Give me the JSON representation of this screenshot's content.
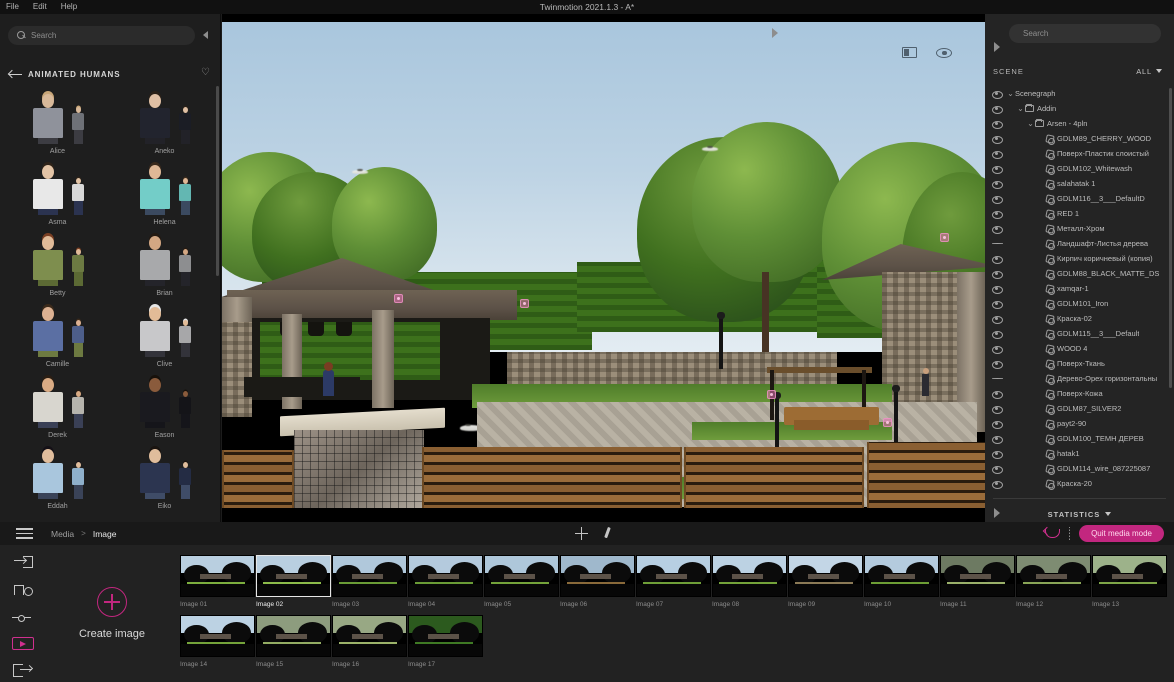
{
  "window": {
    "title": "Twinmotion 2021.1.3 - A*",
    "menu": [
      "File",
      "Edit",
      "Help"
    ]
  },
  "left_panel": {
    "search_placeholder": "Search",
    "category_title": "ANIMATED HUMANS",
    "collapse_icon": "chevron-left-icon",
    "favorite_icon": "heart-icon",
    "back_icon": "back-arrow-icon",
    "items": [
      {
        "name": "Alice",
        "big": "#8f929b",
        "small": "#6e7177",
        "skin": "#d8b99a",
        "hair": "#c8a678",
        "legs": "#3c3c42"
      },
      {
        "name": "Aneko",
        "big": "#22242e",
        "small": "#1b1d25",
        "skin": "#e0c0a4",
        "hair": "#2b2118",
        "legs": "#222228"
      },
      {
        "name": "Asma",
        "big": "#e8e8e8",
        "small": "#d8d8d8",
        "skin": "#e3c4a6",
        "hair": "#2e2319",
        "legs": "#2b3350"
      },
      {
        "name": "Helena",
        "big": "#73cdc8",
        "small": "#63b7b2",
        "skin": "#dfb896",
        "hair": "#3a2a1c",
        "legs": "#3b4a60"
      },
      {
        "name": "Betty",
        "big": "#7e8e4e",
        "small": "#6c7a42",
        "skin": "#e0bb99",
        "hair": "#7a3f23",
        "legs": "#5c6a34"
      },
      {
        "name": "Brian",
        "big": "#a8a9ab",
        "small": "#8d8e90",
        "skin": "#d3a783",
        "hair": "#241a12",
        "legs": "#24242a"
      },
      {
        "name": "Camille",
        "big": "#5b6fa3",
        "small": "#4d5e8a",
        "skin": "#dcb192",
        "hair": "#3b2a1b",
        "legs": "#6d7a41"
      },
      {
        "name": "Clive",
        "big": "#c8c8ca",
        "small": "#a7a7a9",
        "skin": "#e2bb97",
        "hair": "#e6e6e6",
        "legs": "#33333a"
      },
      {
        "name": "Derek",
        "big": "#d8d6cf",
        "small": "#b6b4ad",
        "skin": "#d9ab84",
        "hair": "#2a1e14",
        "legs": "#3a4056"
      },
      {
        "name": "Eason",
        "big": "#1a1a1f",
        "small": "#141418",
        "skin": "#8a5b3c",
        "hair": "#17110b",
        "legs": "#15151a"
      },
      {
        "name": "Eddah",
        "big": "#a9c6dd",
        "small": "#8fb0cb",
        "skin": "#e0bd9c",
        "hair": "#141016",
        "legs": "#3a4358"
      },
      {
        "name": "Eiko",
        "big": "#2c3550",
        "small": "#242c44",
        "skin": "#e0bd9c",
        "hair": "#1a1410",
        "legs": "#3f4c67"
      }
    ]
  },
  "viewport": {
    "layout_icon": "panel-layout-icon",
    "eye_icon": "eye-icon",
    "expand_right_icon": "chevron-right-icon"
  },
  "right_panel": {
    "search_placeholder": "Search",
    "collapse_icon": "chevron-right-icon",
    "scene_label": "SCENE",
    "filter_label": "ALL",
    "statistics_label": "STATISTICS",
    "tree": [
      {
        "label": "Scenegraph",
        "depth": 0,
        "type": "root",
        "caret": "v",
        "eye": "open"
      },
      {
        "label": "Addin",
        "depth": 1,
        "type": "folder",
        "caret": "v",
        "eye": "open"
      },
      {
        "label": "Arsen - 4pln",
        "depth": 2,
        "type": "folder",
        "caret": "v",
        "eye": "open"
      },
      {
        "label": "GDLM89_CHERRY_WOOD",
        "depth": 3,
        "type": "material",
        "caret": "",
        "eye": "open"
      },
      {
        "label": "Поверх-Пластик слоистый",
        "depth": 3,
        "type": "material",
        "caret": "",
        "eye": "open"
      },
      {
        "label": "GDLM102_Whitewash",
        "depth": 3,
        "type": "material",
        "caret": "",
        "eye": "open"
      },
      {
        "label": "salahatak 1",
        "depth": 3,
        "type": "material",
        "caret": "",
        "eye": "open"
      },
      {
        "label": "GDLM116__3___DefaultD",
        "depth": 3,
        "type": "material",
        "caret": "",
        "eye": "open"
      },
      {
        "label": "RED 1",
        "depth": 3,
        "type": "material",
        "caret": "",
        "eye": "open"
      },
      {
        "label": "Металл-Хром",
        "depth": 3,
        "type": "material",
        "caret": "",
        "eye": "open"
      },
      {
        "label": "Ландшафт-Листья дерева",
        "depth": 3,
        "type": "material",
        "caret": "",
        "eye": "closed"
      },
      {
        "label": "Кирпич коричневый (копия)",
        "depth": 3,
        "type": "material",
        "caret": "",
        "eye": "open"
      },
      {
        "label": "GDLM88_BLACK_MATTE_DS",
        "depth": 3,
        "type": "material",
        "caret": "",
        "eye": "open"
      },
      {
        "label": "xamqar-1",
        "depth": 3,
        "type": "material",
        "caret": "",
        "eye": "open"
      },
      {
        "label": "GDLM101_Iron",
        "depth": 3,
        "type": "material",
        "caret": "",
        "eye": "open"
      },
      {
        "label": "Краска-02",
        "depth": 3,
        "type": "material",
        "caret": "",
        "eye": "open"
      },
      {
        "label": "GDLM115__3___Default",
        "depth": 3,
        "type": "material",
        "caret": "",
        "eye": "open"
      },
      {
        "label": "WOOD 4",
        "depth": 3,
        "type": "material",
        "caret": "",
        "eye": "open"
      },
      {
        "label": "Поверх-Ткань",
        "depth": 3,
        "type": "material",
        "caret": "",
        "eye": "open"
      },
      {
        "label": "Дерево-Орех горизонтальны",
        "depth": 3,
        "type": "material",
        "caret": "",
        "eye": "closed"
      },
      {
        "label": "Поверх-Кожа",
        "depth": 3,
        "type": "material",
        "caret": "",
        "eye": "open"
      },
      {
        "label": "GDLM87_SILVER2",
        "depth": 3,
        "type": "material",
        "caret": "",
        "eye": "open"
      },
      {
        "label": "payt2-90",
        "depth": 3,
        "type": "material",
        "caret": "",
        "eye": "open"
      },
      {
        "label": "GDLM100_ТЕМН ДЕРЕВ",
        "depth": 3,
        "type": "material",
        "caret": "",
        "eye": "open"
      },
      {
        "label": "hatak1",
        "depth": 3,
        "type": "material",
        "caret": "",
        "eye": "open"
      },
      {
        "label": "GDLM114_wire_087225087",
        "depth": 3,
        "type": "material",
        "caret": "",
        "eye": "open"
      },
      {
        "label": "Краска-20",
        "depth": 3,
        "type": "material",
        "caret": "",
        "eye": "open"
      }
    ]
  },
  "dock": {
    "menu_icon": "hamburger-icon",
    "breadcrumb_root": "Media",
    "breadcrumb_sep": ">",
    "breadcrumb_current": "Image",
    "move_icon": "move-tool-icon",
    "pen_icon": "eyedropper-icon",
    "undo_icon": "undo-icon",
    "quit_label": "Quit media mode",
    "accent_color": "#c2277f"
  },
  "media_panel": {
    "rail": [
      {
        "name": "import-icon"
      },
      {
        "name": "animation-icon"
      },
      {
        "name": "timeline-slider-icon"
      },
      {
        "name": "media-image-icon"
      },
      {
        "name": "export-icon"
      }
    ],
    "create_label": "Create image",
    "create_icon": "plus-circle-icon",
    "selected": "Image 02",
    "thumbnails_row1": [
      {
        "label": "Image 01",
        "sky": "#b9cfe0",
        "accent": "#7cae3e"
      },
      {
        "label": "Image 02",
        "sky": "#b9cfe0",
        "accent": "#8cbb4a"
      },
      {
        "label": "Image 03",
        "sky": "#b0c8db",
        "accent": "#6a9c36"
      },
      {
        "label": "Image 04",
        "sky": "#b4cadd",
        "accent": "#6a9c36"
      },
      {
        "label": "Image 05",
        "sky": "#aec7da",
        "accent": "#74a33a"
      },
      {
        "label": "Image 06",
        "sky": "#9fb8cc",
        "accent": "#8a6a3a"
      },
      {
        "label": "Image 07",
        "sky": "#b7cfe2",
        "accent": "#6f9f38"
      },
      {
        "label": "Image 08",
        "sky": "#bcd2e3",
        "accent": "#74a33a"
      },
      {
        "label": "Image 09",
        "sky": "#c3d6e6",
        "accent": "#8b7a56"
      },
      {
        "label": "Image 10",
        "sky": "#b4cbde",
        "accent": "#6d9e35"
      },
      {
        "label": "Image 11",
        "sky": "#6d7a62",
        "accent": "#9ab06a"
      },
      {
        "label": "Image 12",
        "sky": "#7e8c72",
        "accent": "#89a557"
      },
      {
        "label": "Image 13",
        "sky": "#9db28a",
        "accent": "#7ea648"
      }
    ],
    "thumbnails_row2": [
      {
        "label": "Image 14",
        "sky": "#bcd2e3",
        "accent": "#74a33a"
      },
      {
        "label": "Image 15",
        "sky": "#8d9c7e",
        "accent": "#93ac63"
      },
      {
        "label": "Image 16",
        "sky": "#98a884",
        "accent": "#9cb36a"
      },
      {
        "label": "Image 17",
        "sky": "#2c5a1e",
        "accent": "#3f7a24"
      }
    ]
  }
}
